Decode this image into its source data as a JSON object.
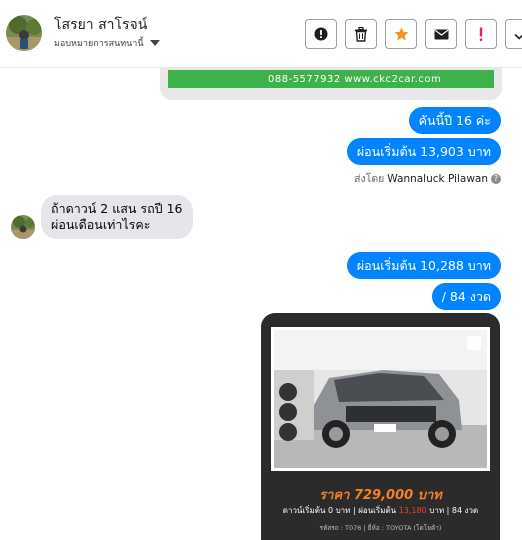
{
  "header": {
    "contact_name": "โสรยา สาโรจน์",
    "assignment_label": "มอบหมายการสนทนานี้",
    "toolbar": [
      {
        "name": "alert-circle",
        "color": "#1c1e21"
      },
      {
        "name": "trash",
        "color": "#1c1e21"
      },
      {
        "name": "star",
        "color": "#f5921e"
      },
      {
        "name": "envelope",
        "color": "#1c1e21"
      },
      {
        "name": "exclamation",
        "color": "#e0245e"
      },
      {
        "name": "checkmark",
        "color": "#1c1e21"
      }
    ]
  },
  "messages": {
    "prev_card_text": "088-5577932  www.ckc2car.com",
    "m1": "คันนี้ปี 16 ค่ะ",
    "m2": "ผ่อนเริ่มต้น  13,903 บาท",
    "sent_by_prefix": "ส่งโดย",
    "sent_by_name": "Wannaluck Pilawan",
    "incoming_line1": "ถ้าดาวน์  2 แสน รถปี 16",
    "incoming_line2": "ผ่อนเดือนเท่าไรคะ",
    "m3": "ผ่อนเริ่มต้น    10,288 บาท",
    "m4": "/ 84 งวด"
  },
  "card": {
    "price": "ราคา 729,000 บาท",
    "terms_prefix": "ดาวน์เริ่มต้น 0 บาท | ผ่อนเริ่มต้น",
    "terms_highlight": "13,180",
    "terms_suffix": "บาท | 84 งวด",
    "meta": "รหัสรถ : T076 | ยี่ห้อ : TOYOTA (โตโยต้า)"
  },
  "colors": {
    "outgoing_bubble": "#0084ff",
    "incoming_bubble": "#e4e6eb",
    "price_orange": "#f5821f"
  }
}
